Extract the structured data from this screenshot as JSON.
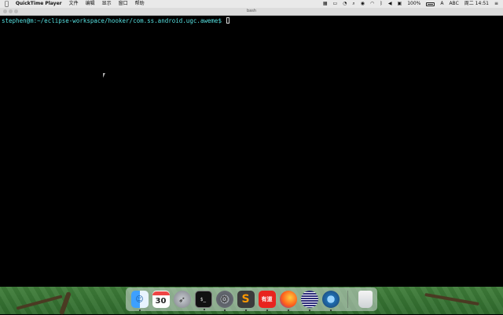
{
  "menubar": {
    "app_name": "QuickTime Player",
    "menus": [
      "文件",
      "编辑",
      "显示",
      "窗口",
      "帮助"
    ],
    "status": {
      "battery": "100%",
      "input": "ABC",
      "clock": "周二 14:51"
    }
  },
  "terminal": {
    "title": "bash",
    "prompt": "stephen@m:~/eclipse-workspace/hooker/com.ss.android.ugc.aweme$ "
  },
  "dock": {
    "calendar_day": "30",
    "netease_label": "有道",
    "items": [
      "finder-icon",
      "calendar-icon",
      "launchpad-icon",
      "terminal-icon",
      "system-preferences-icon",
      "sublime-text-icon",
      "youdao-dict-icon",
      "firefox-icon",
      "eclipse-icon",
      "quicktime-icon",
      "trash-icon"
    ]
  },
  "colors": {
    "prompt": "#56e0e0",
    "menubar": "#e9e9e9",
    "terminal_bg": "#000000"
  }
}
